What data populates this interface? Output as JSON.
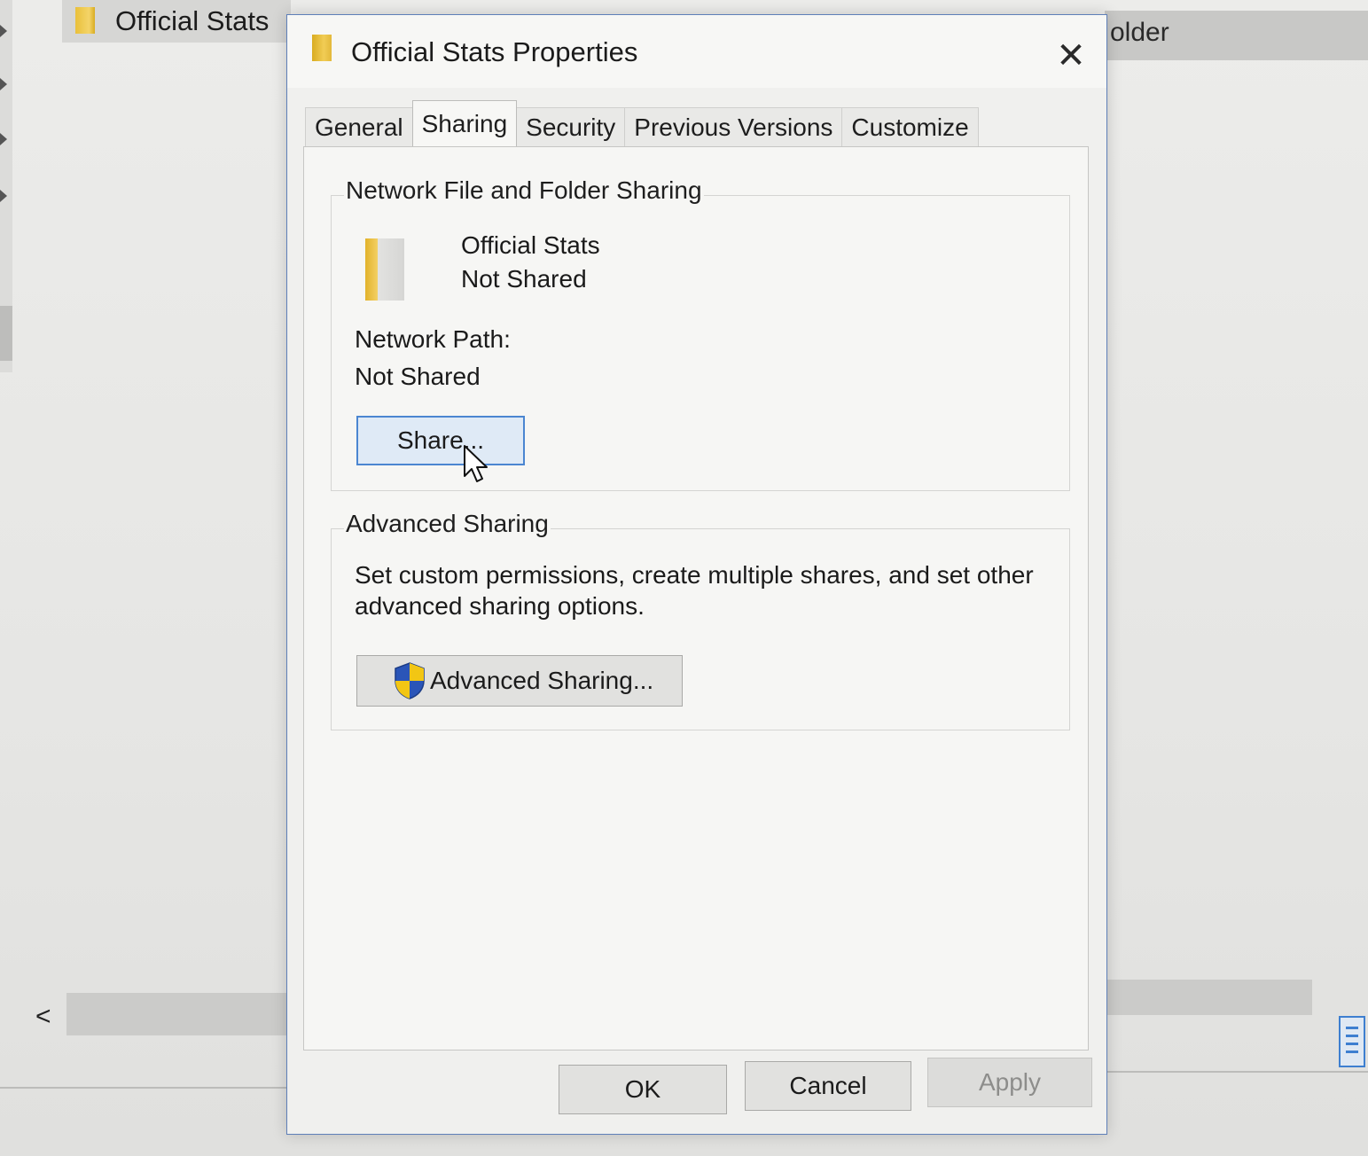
{
  "explorer": {
    "selected_item_name": "Official Stats",
    "column_header_partial": "older",
    "scroll_left_glyph": "<"
  },
  "dialog": {
    "title": "Official Stats Properties",
    "close_glyph": "✕",
    "tabs": [
      {
        "label": "General",
        "active": false
      },
      {
        "label": "Sharing",
        "active": true
      },
      {
        "label": "Security",
        "active": false
      },
      {
        "label": "Previous Versions",
        "active": false
      },
      {
        "label": "Customize",
        "active": false
      }
    ],
    "network_sharing": {
      "legend": "Network File and Folder Sharing",
      "folder_name": "Official Stats",
      "share_status": "Not Shared",
      "network_path_label": "Network Path:",
      "network_path_value": "Not Shared",
      "share_button_label": "Share..."
    },
    "advanced_sharing": {
      "legend": "Advanced Sharing",
      "description": "Set custom permissions, create multiple shares, and set other advanced sharing options.",
      "button_label": "Advanced Sharing..."
    },
    "footer": {
      "ok_label": "OK",
      "cancel_label": "Cancel",
      "apply_label": "Apply",
      "apply_enabled": false
    }
  },
  "icons": {
    "folder": "folder-icon",
    "uac_shield": "uac-shield-icon",
    "mouse_cursor": "mouse-cursor-icon",
    "close": "close-icon",
    "details_view": "details-view-icon"
  },
  "colors": {
    "focus_blue": "#4b86d1",
    "folder_yellow": "#f1cc55",
    "dialog_border": "#5e7fb8"
  }
}
